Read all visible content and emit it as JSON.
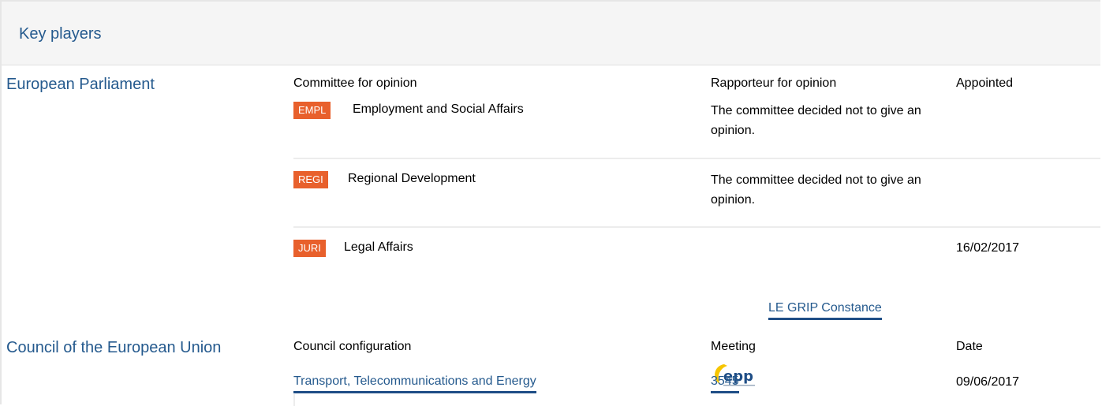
{
  "header": {
    "title": "Key players"
  },
  "parliament": {
    "label": "European Parliament",
    "col_committee": "Committee for opinion",
    "col_rapporteur": "Rapporteur for opinion",
    "col_appointed": "Appointed",
    "rows": [
      {
        "code": "EMPL",
        "name": "Employment and Social Affairs",
        "rapporteur": "The committee decided not to give an opinion.",
        "appointed": ""
      },
      {
        "code": "REGI",
        "name": "Regional Development",
        "rapporteur": "The committee decided not to give an opinion.",
        "appointed": ""
      },
      {
        "code": "JURI",
        "name": "Legal Affairs",
        "rapporteur": "",
        "appointed": "16/02/2017",
        "rapporteur_person": "LE GRIP Constance",
        "group_logo": "epp"
      }
    ]
  },
  "council": {
    "label": "Council of the European Union",
    "col_configuration": "Council configuration",
    "col_meeting": "Meeting",
    "col_date": "Date",
    "configuration": "Transport, Telecommunications and Energy",
    "meeting": "3545",
    "date": "09/06/2017"
  },
  "colors": {
    "link": "#255a8e",
    "badge": "#e8602c",
    "header_bg": "#f5f5f5"
  }
}
